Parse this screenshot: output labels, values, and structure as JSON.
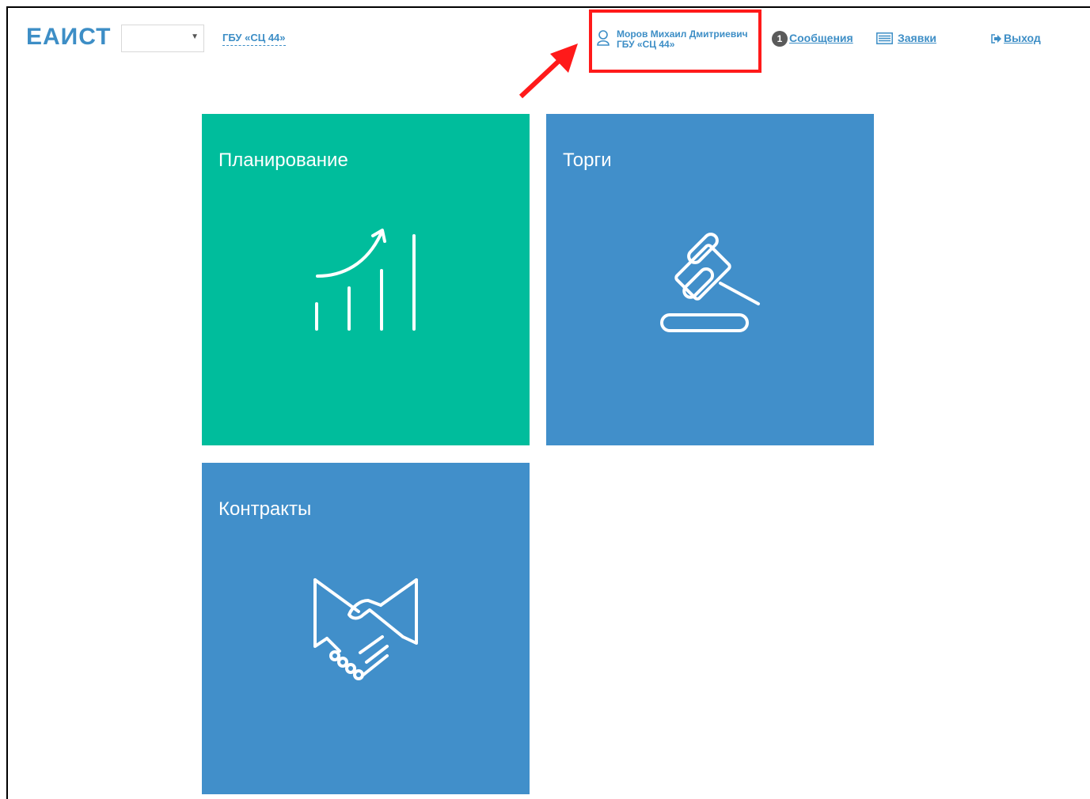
{
  "header": {
    "logo": "ЕАИСТ",
    "org_link": "ГБУ «СЦ 44»",
    "user": {
      "name": "Моров Михаил Дмитриевич",
      "org": "ГБУ «СЦ 44»"
    },
    "messages": {
      "count": "1",
      "label": "Сообщения"
    },
    "orders_label": "Заявки",
    "logout_label": "Выход"
  },
  "tiles": [
    {
      "title": "Планирование",
      "icon": "growth-chart-icon",
      "color": "#00bd9c"
    },
    {
      "title": "Торги",
      "icon": "gavel-icon",
      "color": "#418fca"
    },
    {
      "title": "Контракты",
      "icon": "handshake-icon",
      "color": "#418fca"
    }
  ],
  "annotation": {
    "highlight_color": "#ff1a1a"
  }
}
